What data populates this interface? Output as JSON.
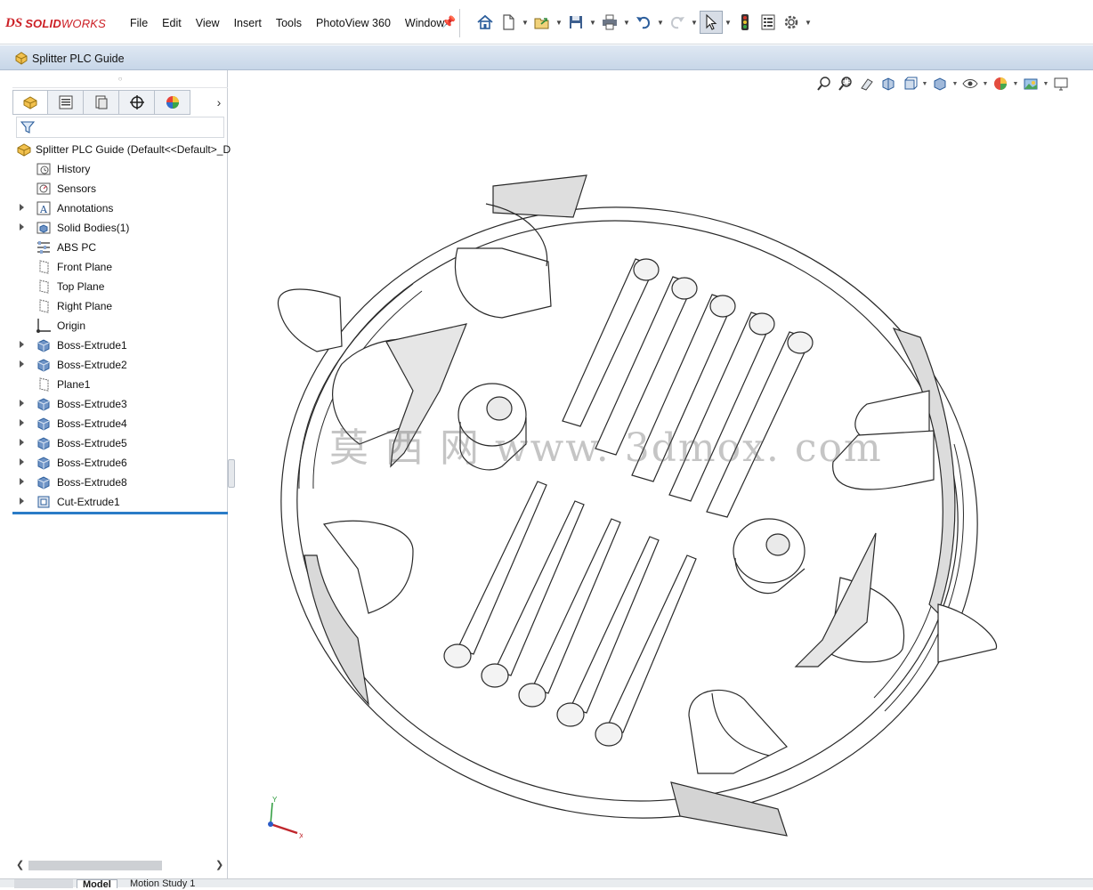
{
  "app": {
    "brand_prefix": "DS",
    "brand_bold": "SOLID",
    "brand_light": "WORKS",
    "menus": [
      "File",
      "Edit",
      "View",
      "Insert",
      "Tools",
      "PhotoView 360",
      "Window"
    ]
  },
  "toolbar": {
    "icons": [
      "home-icon",
      "new-document-icon",
      "open-icon",
      "save-icon",
      "print-icon",
      "undo-icon",
      "redo-icon",
      "select-pointer-icon",
      "rebuild-traffic-light-icon",
      "file-properties-icon",
      "options-gear-icon"
    ]
  },
  "document": {
    "title": "Splitter PLC Guide"
  },
  "feature_manager": {
    "tabs": [
      "feature-manager-tab",
      "property-manager-tab",
      "configuration-manager-tab",
      "dimxpert-manager-tab",
      "display-manager-tab"
    ],
    "root": "Splitter PLC Guide  (Default<<Default>_D",
    "items": [
      {
        "label": "History",
        "icon": "history-icon",
        "expandable": false
      },
      {
        "label": "Sensors",
        "icon": "sensors-icon",
        "expandable": false
      },
      {
        "label": "Annotations",
        "icon": "annotations-icon",
        "expandable": true
      },
      {
        "label": "Solid Bodies(1)",
        "icon": "solid-bodies-icon",
        "expandable": true
      },
      {
        "label": "ABS PC",
        "icon": "material-icon",
        "expandable": false
      },
      {
        "label": "Front Plane",
        "icon": "plane-icon",
        "expandable": false
      },
      {
        "label": "Top Plane",
        "icon": "plane-icon",
        "expandable": false
      },
      {
        "label": "Right Plane",
        "icon": "plane-icon",
        "expandable": false
      },
      {
        "label": "Origin",
        "icon": "origin-icon",
        "expandable": false
      },
      {
        "label": "Boss-Extrude1",
        "icon": "extrude-icon",
        "expandable": true
      },
      {
        "label": "Boss-Extrude2",
        "icon": "extrude-icon",
        "expandable": true
      },
      {
        "label": "Plane1",
        "icon": "plane-icon",
        "expandable": false
      },
      {
        "label": "Boss-Extrude3",
        "icon": "extrude-icon",
        "expandable": true
      },
      {
        "label": "Boss-Extrude4",
        "icon": "extrude-icon",
        "expandable": true
      },
      {
        "label": "Boss-Extrude5",
        "icon": "extrude-icon",
        "expandable": true
      },
      {
        "label": "Boss-Extrude6",
        "icon": "extrude-icon",
        "expandable": true
      },
      {
        "label": "Boss-Extrude8",
        "icon": "extrude-icon",
        "expandable": true
      },
      {
        "label": "Cut-Extrude1",
        "icon": "cut-extrude-icon",
        "expandable": true
      }
    ]
  },
  "bottom_tabs": {
    "model": "Model",
    "motion": "Motion Study 1"
  },
  "viewport": {
    "heads_up_icons": [
      "zoom-to-fit-icon",
      "zoom-to-area-icon",
      "previous-view-icon",
      "section-view-icon",
      "view-orientation-icon",
      "display-style-icon",
      "hide-show-icon",
      "edit-appearance-icon",
      "apply-scene-icon",
      "view-settings-icon"
    ],
    "triad_x": "X",
    "triad_y": "Y",
    "watermark": "莫 西 网 www. 3dmox. com"
  }
}
